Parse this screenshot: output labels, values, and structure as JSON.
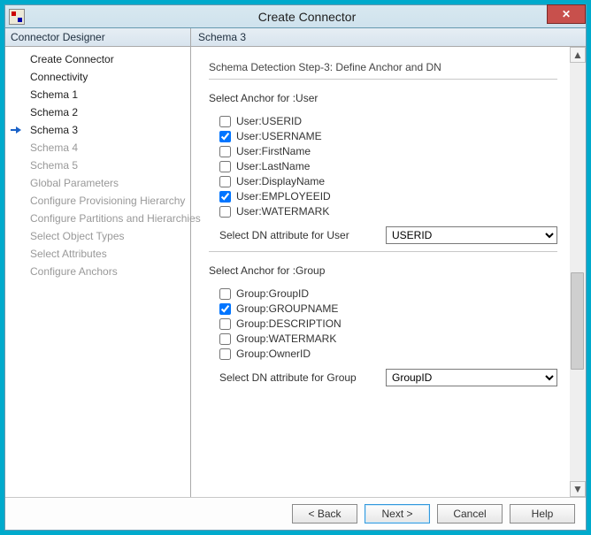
{
  "window": {
    "title": "Create Connector"
  },
  "sidebar": {
    "header": "Connector Designer",
    "items": [
      {
        "label": "Create Connector",
        "state": "done"
      },
      {
        "label": "Connectivity",
        "state": "done"
      },
      {
        "label": "Schema 1",
        "state": "done"
      },
      {
        "label": "Schema 2",
        "state": "done"
      },
      {
        "label": "Schema 3",
        "state": "current"
      },
      {
        "label": "Schema 4",
        "state": "pending"
      },
      {
        "label": "Schema 5",
        "state": "pending"
      },
      {
        "label": "Global Parameters",
        "state": "pending"
      },
      {
        "label": "Configure Provisioning Hierarchy",
        "state": "pending"
      },
      {
        "label": "Configure Partitions and Hierarchies",
        "state": "pending"
      },
      {
        "label": "Select Object Types",
        "state": "pending"
      },
      {
        "label": "Select Attributes",
        "state": "pending"
      },
      {
        "label": "Configure Anchors",
        "state": "pending"
      }
    ]
  },
  "main": {
    "header": "Schema 3",
    "step_title": "Schema Detection Step-3: Define Anchor and DN",
    "user_section": {
      "label": "Select Anchor for :User",
      "checks": [
        {
          "label": "User:USERID",
          "checked": false
        },
        {
          "label": "User:USERNAME",
          "checked": true
        },
        {
          "label": "User:FirstName",
          "checked": false
        },
        {
          "label": "User:LastName",
          "checked": false
        },
        {
          "label": "User:DisplayName",
          "checked": false
        },
        {
          "label": "User:EMPLOYEEID",
          "checked": true
        },
        {
          "label": "User:WATERMARK",
          "checked": false
        }
      ],
      "dn_label": "Select DN attribute for User",
      "dn_value": "USERID"
    },
    "group_section": {
      "label": "Select Anchor for :Group",
      "checks": [
        {
          "label": "Group:GroupID",
          "checked": false
        },
        {
          "label": "Group:GROUPNAME",
          "checked": true
        },
        {
          "label": "Group:DESCRIPTION",
          "checked": false
        },
        {
          "label": "Group:WATERMARK",
          "checked": false
        },
        {
          "label": "Group:OwnerID",
          "checked": false
        }
      ],
      "dn_label": "Select DN attribute for Group",
      "dn_value": "GroupID"
    }
  },
  "buttons": {
    "back": "<  Back",
    "next": "Next  >",
    "cancel": "Cancel",
    "help": "Help"
  },
  "icons": {
    "close": "✕",
    "up": "▲",
    "down": "▼"
  }
}
